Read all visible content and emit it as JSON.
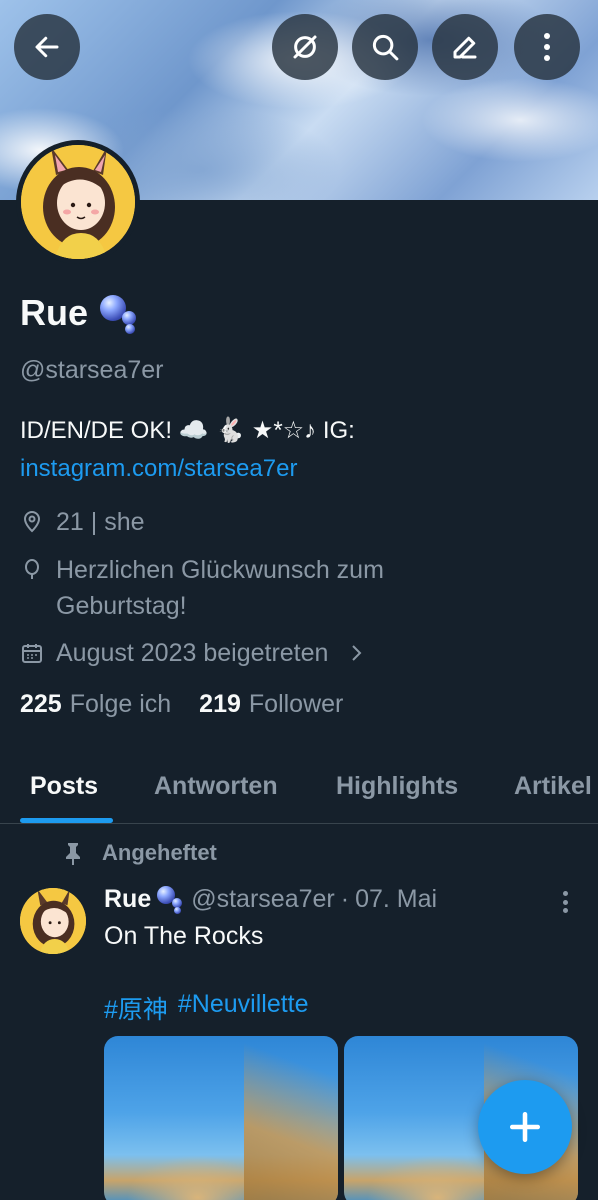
{
  "header": {
    "back_icon": "arrow-left-icon",
    "grok_icon": "no-symbol-icon",
    "search_icon": "search-icon",
    "edit_icon": "pencil-icon",
    "more_icon": "kebab-icon"
  },
  "profile": {
    "name": "Rue",
    "handle": "@starsea7er",
    "bio_text": "ID/EN/DE OK! ☁️ 🐇 ★*☆♪  IG:",
    "bio_link": "instagram.com/starsea7er",
    "location": "21 | she",
    "birthday": "Herzlichen Glückwunsch zum Geburtstag!",
    "joined": "August 2023 beigetreten",
    "following_count": "225",
    "following_label": "Folge ich",
    "followers_count": "219",
    "followers_label": "Follower"
  },
  "tabs": [
    {
      "label": "Posts",
      "active": true
    },
    {
      "label": "Antworten",
      "active": false
    },
    {
      "label": "Highlights",
      "active": false
    },
    {
      "label": "Artikel",
      "active": false
    }
  ],
  "post": {
    "pinned_label": "Angeheftet",
    "author_name": "Rue",
    "author_handle": "@starsea7er",
    "separator": "·",
    "date": "07. Mai",
    "text": "On The Rocks",
    "hashtag_1": "#原神",
    "hashtag_2": "#Neuvillette"
  },
  "colors": {
    "background": "#15202b",
    "accent": "#1d9bf0",
    "muted_text": "#8b98a5"
  }
}
